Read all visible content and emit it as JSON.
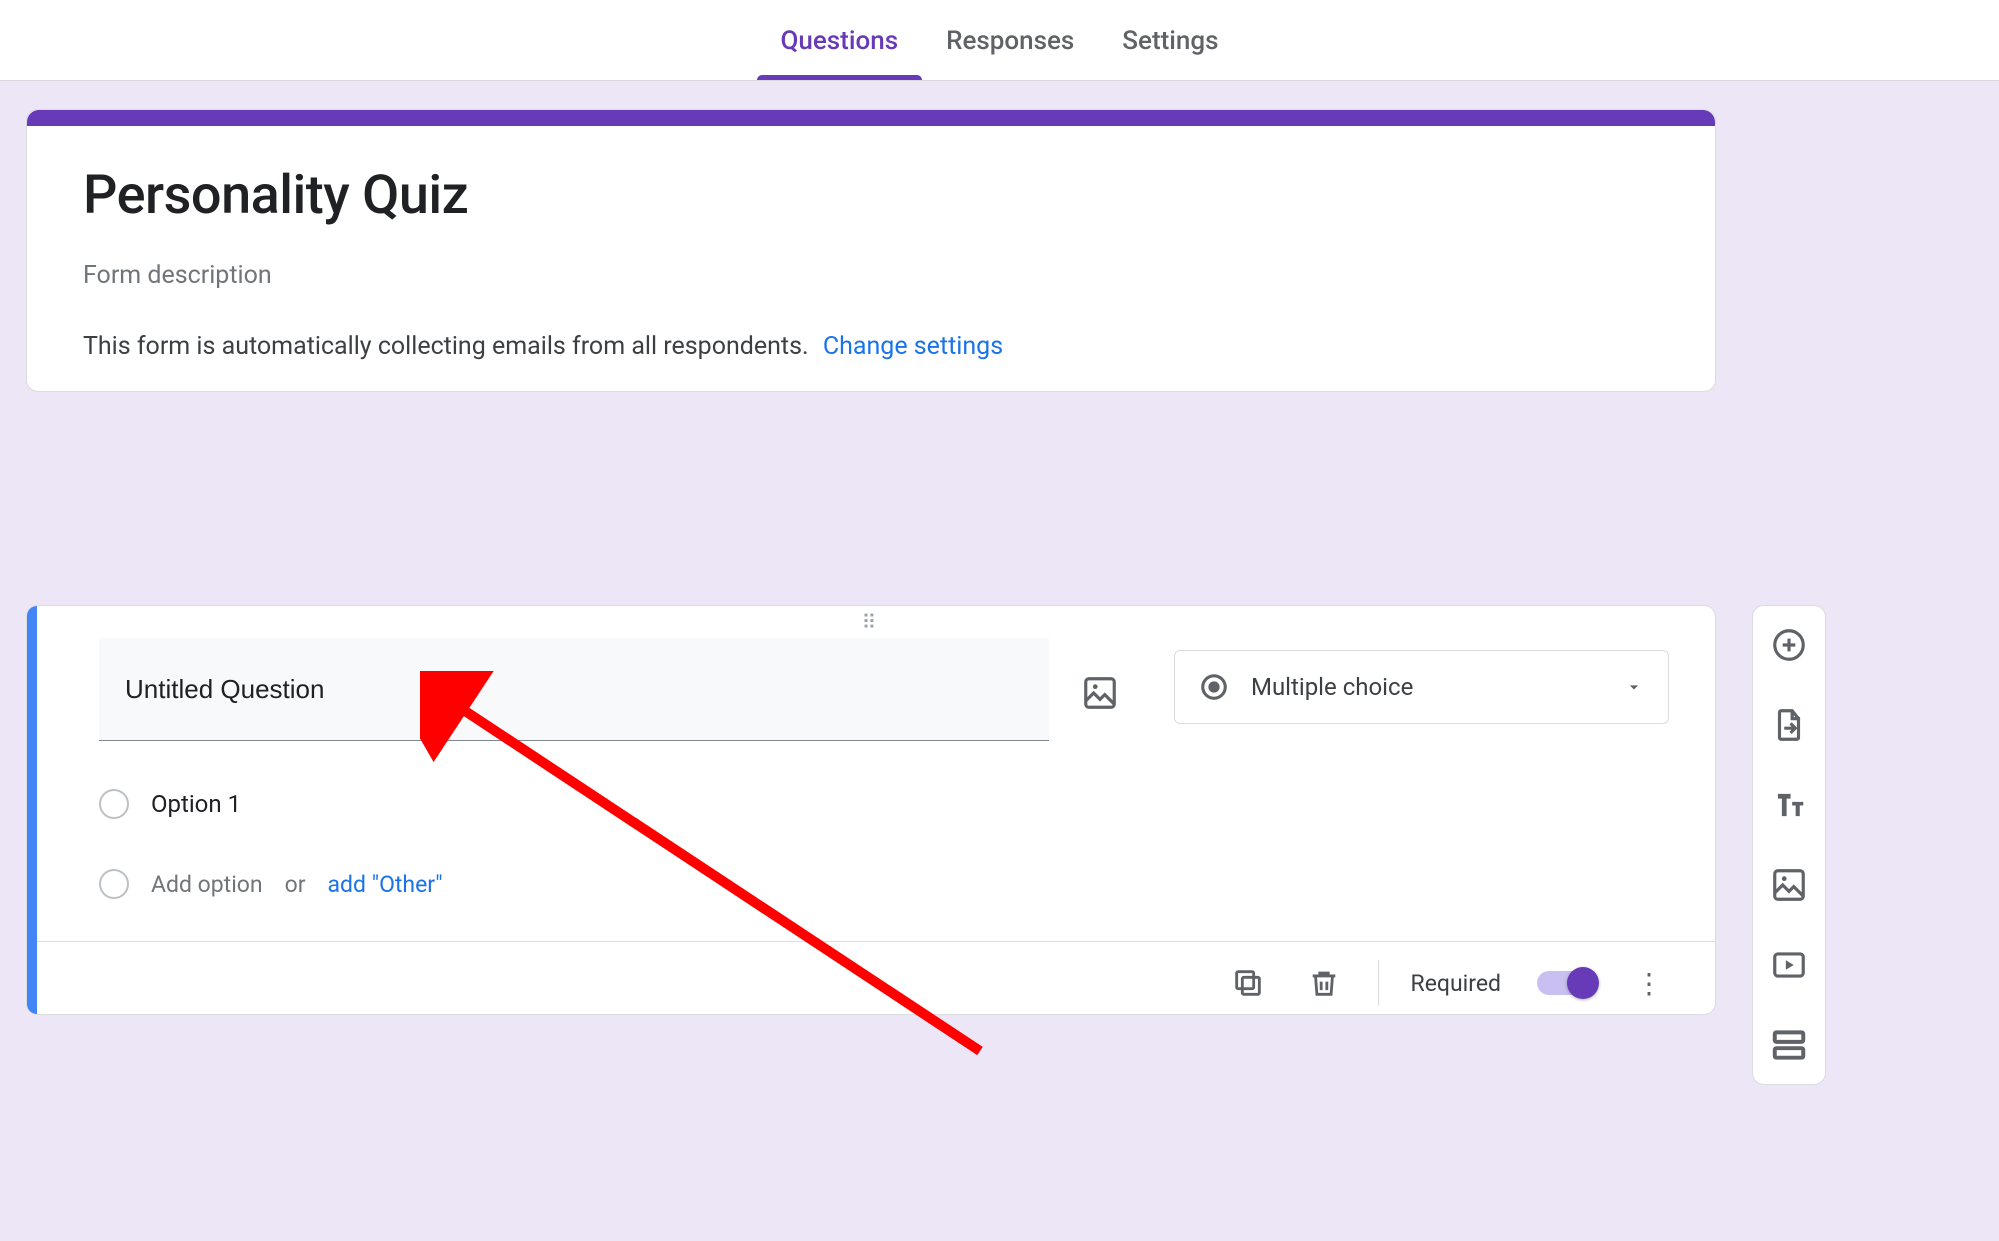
{
  "tabs": {
    "questions": "Questions",
    "responses": "Responses",
    "settings": "Settings"
  },
  "form": {
    "title": "Personality Quiz",
    "description_placeholder": "Form description",
    "email_collection_note": "This form is automatically collecting emails from all respondents.",
    "change_settings_link": "Change settings"
  },
  "question": {
    "title_placeholder": "Untitled Question",
    "type_label": "Multiple choice",
    "option1": "Option 1",
    "add_option": "Add option",
    "or_text": "or",
    "add_other": "add \"Other\"",
    "required_label": "Required"
  }
}
